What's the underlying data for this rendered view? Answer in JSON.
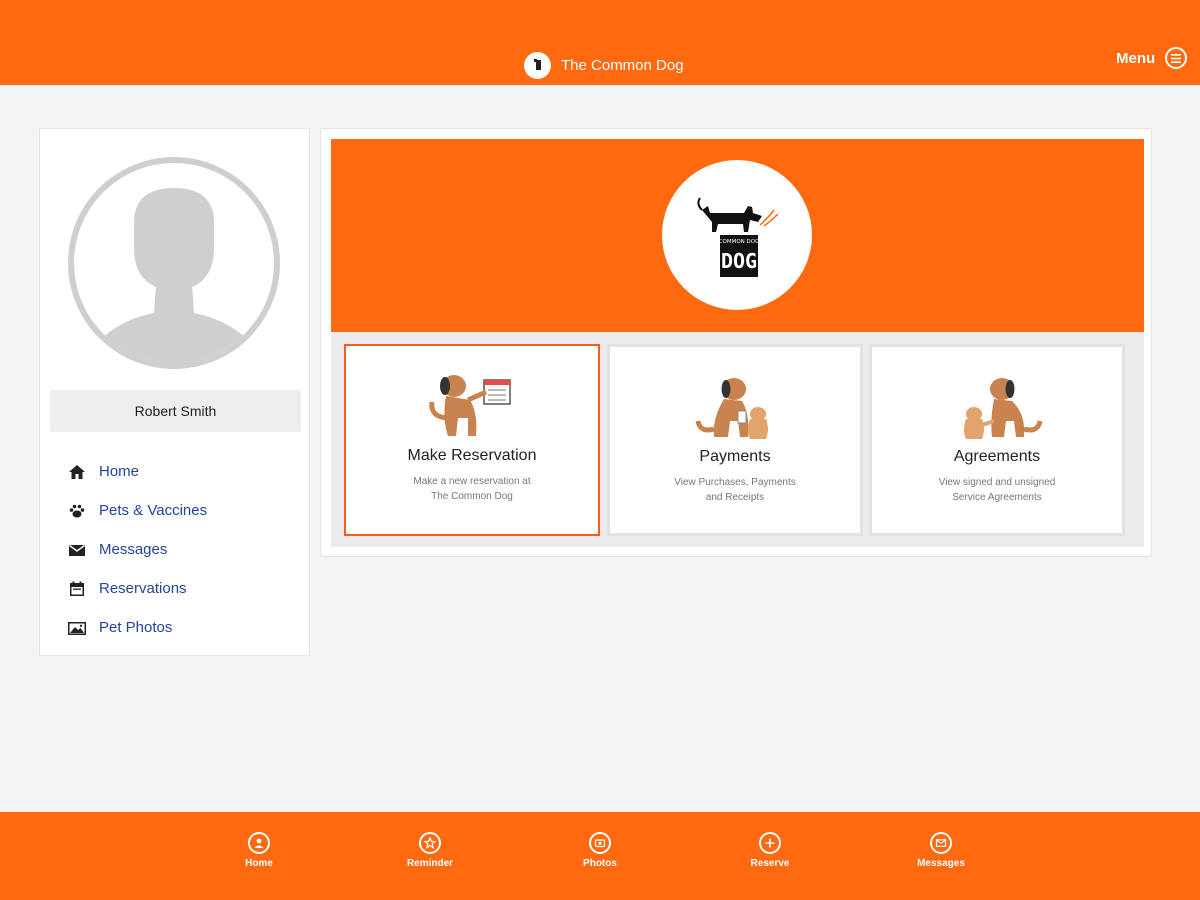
{
  "header": {
    "brand_name": "The Common Dog",
    "menu_label": "Menu"
  },
  "sidebar": {
    "user_name": "Robert Smith",
    "nav": [
      {
        "label": "Home",
        "icon": "home-icon"
      },
      {
        "label": "Pets & Vaccines",
        "icon": "paw-icon"
      },
      {
        "label": "Messages",
        "icon": "envelope-icon"
      },
      {
        "label": "Reservations",
        "icon": "calendar-icon"
      },
      {
        "label": "Pet Photos",
        "icon": "photo-icon"
      }
    ]
  },
  "hero": {
    "logo_text": "COMMON DOG"
  },
  "tiles": [
    {
      "title": "Make Reservation",
      "desc_line1": "Make a new reservation at",
      "desc_line2": "The Common Dog"
    },
    {
      "title": "Payments",
      "desc_line1": "View Purchases, Payments",
      "desc_line2": "and Receipts"
    },
    {
      "title": "Agreements",
      "desc_line1": "View signed and unsigned",
      "desc_line2": "Service Agreements"
    }
  ],
  "bottom_nav": [
    {
      "label": "Home",
      "icon": "home-circle-icon"
    },
    {
      "label": "Reminder",
      "icon": "star-circle-icon"
    },
    {
      "label": "Photos",
      "icon": "photos-circle-icon"
    },
    {
      "label": "Reserve",
      "icon": "plus-circle-icon"
    },
    {
      "label": "Messages",
      "icon": "messages-circle-icon"
    }
  ],
  "colors": {
    "accent": "#ff6a10",
    "nav_link": "#24459a",
    "active_border": "#ff5a1f"
  }
}
